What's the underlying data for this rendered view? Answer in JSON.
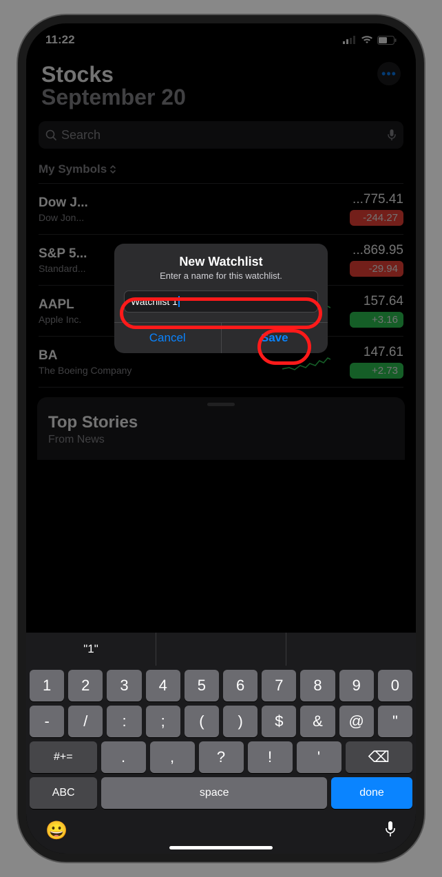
{
  "statusbar": {
    "time": "11:22"
  },
  "header": {
    "title": "Stocks",
    "subtitle": "September 20",
    "more_glyph": "•••"
  },
  "search": {
    "placeholder": "Search"
  },
  "watchlist_selector": {
    "label": "My Symbols"
  },
  "stocks": [
    {
      "symbol": "Dow J...",
      "company": "Dow Jon...",
      "price": "...775.41",
      "change": "-244.27",
      "dir": "down",
      "spark": false
    },
    {
      "symbol": "S&P 5...",
      "company": "Standard...",
      "price": "...869.95",
      "change": "-29.94",
      "dir": "down",
      "spark": false
    },
    {
      "symbol": "AAPL",
      "company": "Apple Inc.",
      "price": "157.64",
      "change": "+3.16",
      "dir": "up",
      "spark": true
    },
    {
      "symbol": "BA",
      "company": "The Boeing Company",
      "price": "147.61",
      "change": "+2.73",
      "dir": "up",
      "spark": true
    }
  ],
  "news": {
    "title": "Top Stories",
    "from_prefix": "From ",
    "from_source": "News"
  },
  "modal": {
    "title": "New Watchlist",
    "subtitle": "Enter a name for this watchlist.",
    "input_value": "Watchlist 1",
    "cancel": "Cancel",
    "save": "Save"
  },
  "keyboard": {
    "predictions": [
      "\"1\"",
      "",
      ""
    ],
    "row1": [
      "1",
      "2",
      "3",
      "4",
      "5",
      "6",
      "7",
      "8",
      "9",
      "0"
    ],
    "row2": [
      "-",
      "/",
      ":",
      ";",
      "(",
      ")",
      "$",
      "&",
      "@",
      "\""
    ],
    "row3_shift": "#+=",
    "row3": [
      ".",
      ",",
      "?",
      "!",
      "'"
    ],
    "row3_del": "⌫",
    "row4_mode": "ABC",
    "row4_space": "space",
    "row4_done": "done",
    "emoji": "😀",
    "mic": "🎤"
  }
}
